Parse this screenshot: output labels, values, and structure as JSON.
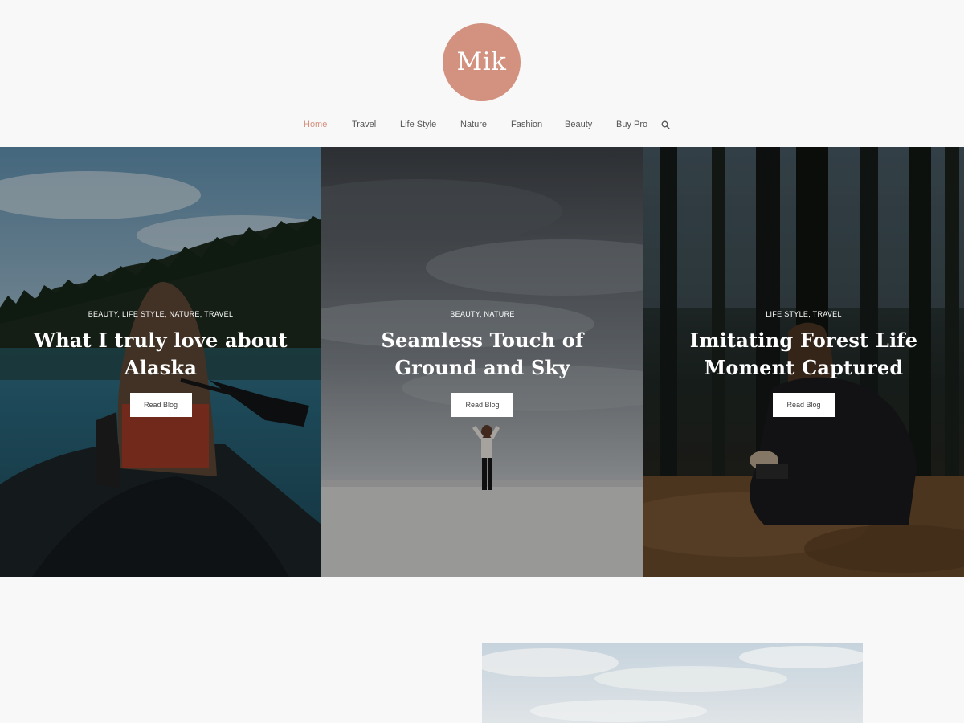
{
  "site": {
    "logo_text": "Mik",
    "brand_color": "#d3917f"
  },
  "nav": {
    "items": [
      {
        "label": "Home",
        "active": true
      },
      {
        "label": "Travel"
      },
      {
        "label": "Life Style"
      },
      {
        "label": "Nature"
      },
      {
        "label": "Fashion"
      },
      {
        "label": "Beauty"
      },
      {
        "label": "Buy Pro"
      }
    ],
    "search_icon": "search-icon"
  },
  "slides": [
    {
      "categories": "BEAUTY, LIFE STYLE, NATURE, TRAVEL",
      "title": "What I truly love about Alaska",
      "button": "Read Blog",
      "image": "woman paddling canoe on lake"
    },
    {
      "categories": "BEAUTY, NATURE",
      "title": "Seamless Touch of Ground and Sky",
      "button": "Read Blog",
      "image": "woman standing under cloudy sky"
    },
    {
      "categories": "LIFE STYLE, TRAVEL",
      "title": "Imitating Forest Life Moment Captured",
      "button": "Read Blog",
      "image": "woman sitting in forest"
    }
  ]
}
